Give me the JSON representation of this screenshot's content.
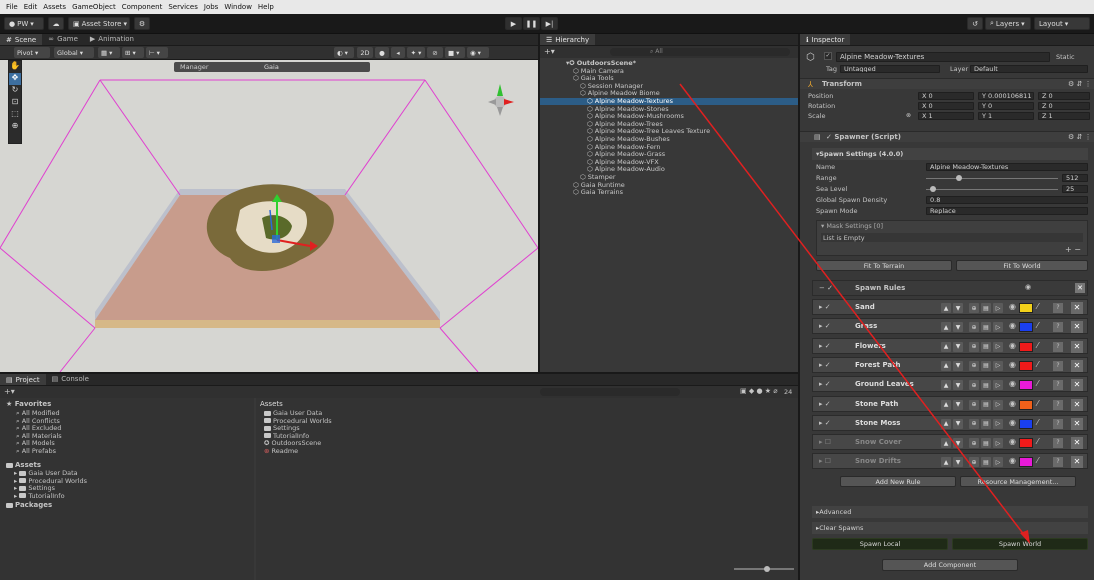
{
  "menu": [
    "File",
    "Edit",
    "Assets",
    "GameObject",
    "Component",
    "Services",
    "Jobs",
    "Window",
    "Help"
  ],
  "toolbar": {
    "account": "PW",
    "asset_store": "Asset Store",
    "layers": "Layers",
    "layout": "Layout"
  },
  "scene_tabs": [
    "Scene",
    "Game",
    "Animation"
  ],
  "scene_toolbar": {
    "pivot": "Pivot",
    "global": "Global",
    "mode_2d": "2D",
    "manager_tab": "Manager",
    "gaia_tab": "Gaia"
  },
  "hierarchy": {
    "tab": "Hierarchy",
    "search_placeholder": "All",
    "items": [
      {
        "label": "OutdoorsScene*",
        "depth": 0,
        "selected": false
      },
      {
        "label": "Main Camera",
        "depth": 1,
        "selected": false
      },
      {
        "label": "Gaia Tools",
        "depth": 1,
        "selected": false
      },
      {
        "label": "Session Manager",
        "depth": 2,
        "selected": false
      },
      {
        "label": "Alpine Meadow Biome",
        "depth": 2,
        "selected": false
      },
      {
        "label": "Alpine Meadow-Textures",
        "depth": 3,
        "selected": true
      },
      {
        "label": "Alpine Meadow-Stones",
        "depth": 3,
        "selected": false
      },
      {
        "label": "Alpine Meadow-Mushrooms",
        "depth": 3,
        "selected": false
      },
      {
        "label": "Alpine Meadow-Trees",
        "depth": 3,
        "selected": false
      },
      {
        "label": "Alpine Meadow-Tree Leaves Texture",
        "depth": 3,
        "selected": false
      },
      {
        "label": "Alpine Meadow-Bushes",
        "depth": 3,
        "selected": false
      },
      {
        "label": "Alpine Meadow-Fern",
        "depth": 3,
        "selected": false
      },
      {
        "label": "Alpine Meadow-Grass",
        "depth": 3,
        "selected": false
      },
      {
        "label": "Alpine Meadow-VFX",
        "depth": 3,
        "selected": false
      },
      {
        "label": "Alpine Meadow-Audio",
        "depth": 3,
        "selected": false
      },
      {
        "label": "Stamper",
        "depth": 2,
        "selected": false
      },
      {
        "label": "Gaia Runtime",
        "depth": 1,
        "selected": false
      },
      {
        "label": "Gaia Terrains",
        "depth": 1,
        "selected": false
      }
    ]
  },
  "project": {
    "tabs": [
      "Project",
      "Console"
    ],
    "favorites_title": "Favorites",
    "favorites": [
      "All Modified",
      "All Conflicts",
      "All Excluded",
      "All Materials",
      "All Models",
      "All Prefabs"
    ],
    "assets_title": "Assets",
    "tree": [
      "Gaia User Data",
      "Procedural Worlds",
      "Settings",
      "TutorialInfo"
    ],
    "packages": "Packages",
    "assets_header": "Assets",
    "assets_list": [
      "Gaia User Data",
      "Procedural Worlds",
      "Settings",
      "TutorialInfo",
      "OutdoorsScene",
      "Readme"
    ],
    "count": "24"
  },
  "inspector": {
    "tab": "Inspector",
    "object_name": "Alpine Meadow-Textures",
    "static_label": "Static",
    "tag_label": "Tag",
    "tag_value": "Untagged",
    "layer_label": "Layer",
    "layer_value": "Default",
    "transform": {
      "title": "Transform",
      "position_label": "Position",
      "rotation_label": "Rotation",
      "scale_label": "Scale",
      "px": "X 0",
      "py": "Y 0.000106811",
      "pz": "Z 0",
      "rx": "X 0",
      "ry": "Y 0",
      "rz": "Z 0",
      "sx": "X 1",
      "sy": "Y 1",
      "sz": "Z 1"
    },
    "spawner": {
      "title": "Spawner (Script)",
      "settings_title": "Spawn Settings (4.0.0)",
      "name_label": "Name",
      "name_value": "Alpine Meadow-Textures",
      "range_label": "Range",
      "range_value": "512",
      "range_fraction": 0.25,
      "sea_label": "Sea Level",
      "sea_value": "25",
      "sea_fraction": 0.05,
      "density_label": "Global Spawn Density",
      "density_value": "0.8",
      "mode_label": "Spawn Mode",
      "mode_value": "Replace",
      "mask_label": "Mask Settings [0]",
      "list_empty": "List is Empty",
      "fit_terrain": "Fit To Terrain",
      "fit_world": "Fit To World",
      "rules_title": "Spawn Rules",
      "rules": [
        {
          "name": "Sand",
          "color": "#f2d11a",
          "enabled": true
        },
        {
          "name": "Grass",
          "color": "#1a3ff0",
          "enabled": true
        },
        {
          "name": "Flowers",
          "color": "#f01a1a",
          "enabled": true
        },
        {
          "name": "Forest Path",
          "color": "#f01a1a",
          "enabled": true
        },
        {
          "name": "Ground Leaves",
          "color": "#e81ad8",
          "enabled": true
        },
        {
          "name": "Stone Path",
          "color": "#f0601a",
          "enabled": true
        },
        {
          "name": "Stone Moss",
          "color": "#1a3ff0",
          "enabled": true
        },
        {
          "name": "Snow Cover",
          "color": "#f01a1a",
          "enabled": false
        },
        {
          "name": "Snow Drifts",
          "color": "#e81ad8",
          "enabled": false
        }
      ],
      "add_rule": "Add New Rule",
      "resource_mgmt": "Resource Management...",
      "advanced": "Advanced",
      "clear_spawns": "Clear Spawns",
      "spawn_local": "Spawn Local",
      "spawn_world": "Spawn World"
    },
    "add_component": "Add Component"
  },
  "colors": {
    "accent_selection": "#2c5d87",
    "annotation_arrow": "#e02020"
  }
}
